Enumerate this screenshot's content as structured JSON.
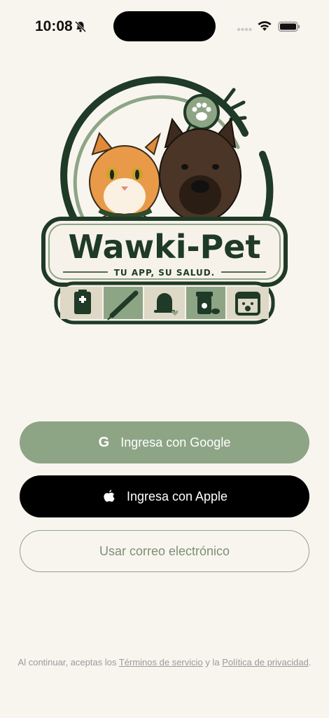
{
  "status_bar": {
    "time": "10:08",
    "icons": [
      "bell-slash-icon",
      "cellular-signal-icon",
      "wifi-icon",
      "battery-icon"
    ]
  },
  "logo": {
    "brand_name": "Wawki-Pet",
    "tagline": "TU APP, SU SALUD.",
    "category_icons": [
      "clipboard-medical-icon",
      "syringe-icon",
      "bell-heart-icon",
      "pill-bottle-icon",
      "calendar-paw-icon"
    ]
  },
  "auth": {
    "google_label": "Ingresa con Google",
    "google_icon": "G",
    "apple_label": "Ingresa con Apple",
    "email_label": "Usar correo electrónico"
  },
  "legal": {
    "prefix": "Al continuar, aceptas los ",
    "terms_link": "Términos de servicio",
    "middle": " y la ",
    "privacy_link": "Política de privacidad",
    "suffix": "."
  },
  "colors": {
    "background": "#f8f5ef",
    "accent_green": "#8ea585",
    "dark_green": "#1f3a26",
    "apple_black": "#000000"
  }
}
